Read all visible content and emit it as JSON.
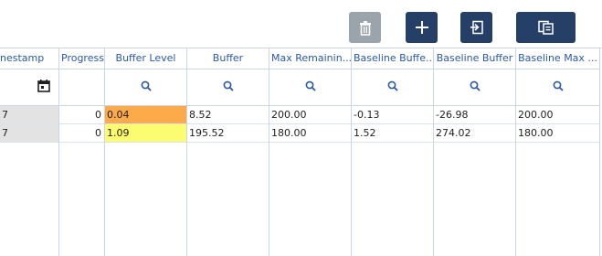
{
  "toolbar": {
    "buttons": [
      {
        "name": "delete",
        "icon": "trash-icon",
        "enabled": false
      },
      {
        "name": "add",
        "icon": "plus-icon",
        "enabled": true
      },
      {
        "name": "import",
        "icon": "import-icon",
        "enabled": true
      },
      {
        "name": "copy",
        "icon": "copy-icon",
        "enabled": true
      }
    ]
  },
  "columns": [
    {
      "key": "timestamp",
      "label": "nestamp",
      "filter_icon": "calendar-icon"
    },
    {
      "key": "progress",
      "label": "Progress",
      "filter_icon": ""
    },
    {
      "key": "buffer_level",
      "label": "Buffer Level",
      "filter_icon": "search-icon"
    },
    {
      "key": "buffer",
      "label": "Buffer",
      "filter_icon": "search-icon"
    },
    {
      "key": "max_remaining",
      "label": "Max Remainin...",
      "filter_icon": "search-icon"
    },
    {
      "key": "baseline_buffer_level",
      "label": "Baseline Buffe...",
      "filter_icon": "search-icon"
    },
    {
      "key": "baseline_buffer",
      "label": "Baseline Buffer",
      "filter_icon": "search-icon"
    },
    {
      "key": "baseline_max",
      "label": "Baseline Max ...",
      "filter_icon": "search-icon"
    }
  ],
  "rows": [
    {
      "timestamp": "7",
      "progress": "0",
      "buffer_level": "0.04",
      "buffer_level_color": "#fcaa4a",
      "buffer": "8.52",
      "max_remaining": "200.00",
      "baseline_buffer_level": "-0.13",
      "baseline_buffer": "-26.98",
      "baseline_max": "200.00"
    },
    {
      "timestamp": "7",
      "progress": "0",
      "buffer_level": "1.09",
      "buffer_level_color": "#fcfc70",
      "buffer": "195.52",
      "max_remaining": "180.00",
      "baseline_buffer_level": "1.52",
      "baseline_buffer": "274.02",
      "baseline_max": "180.00"
    }
  ],
  "colors": {
    "accent": "#263f66",
    "header_text": "#2b5aa5",
    "disabled": "#9ba3ab"
  }
}
